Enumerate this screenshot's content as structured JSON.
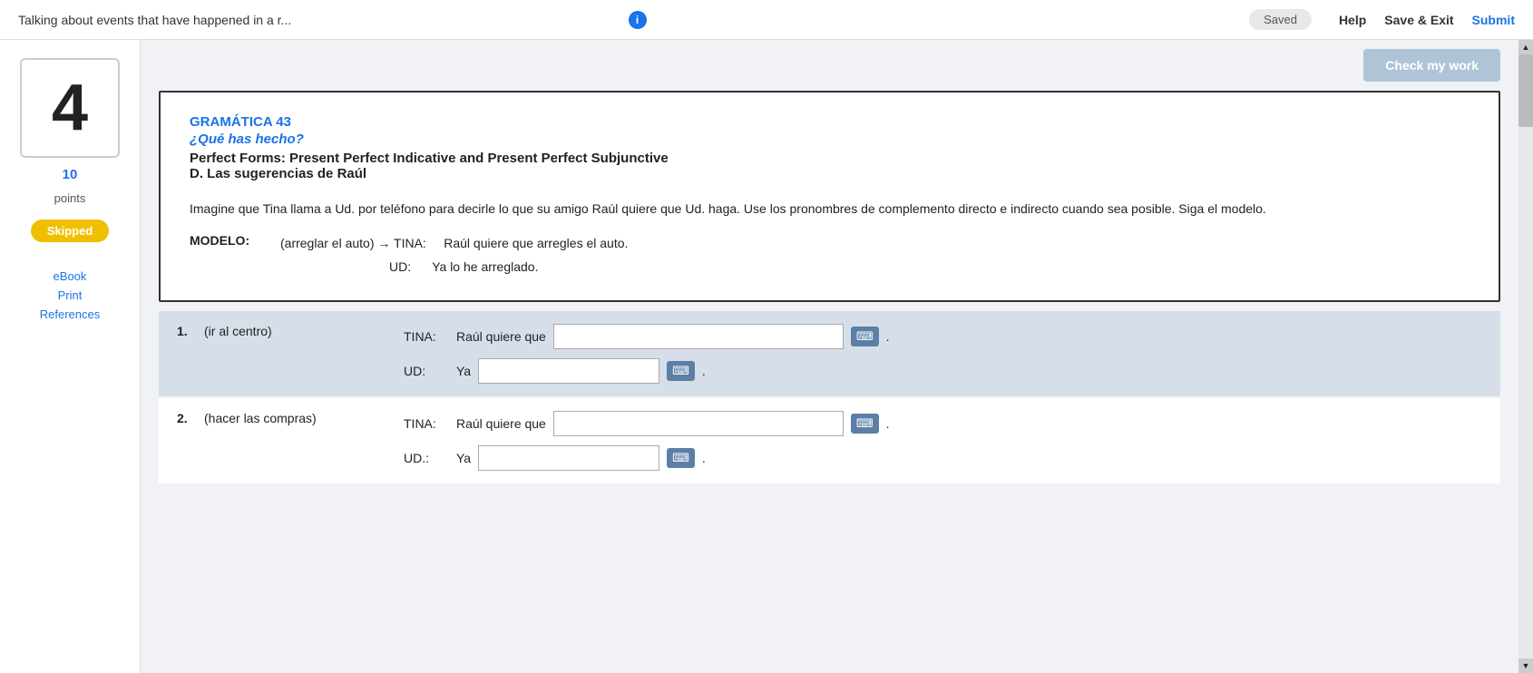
{
  "topbar": {
    "title": "Talking about events that have happened in a r...",
    "saved_label": "Saved",
    "help_label": "Help",
    "save_exit_label": "Save & Exit",
    "submit_label": "Submit"
  },
  "sidebar": {
    "question_number": "4",
    "points_value": "10",
    "points_label": "points",
    "skipped_label": "Skipped",
    "ebook_label": "eBook",
    "print_label": "Print",
    "references_label": "References"
  },
  "check_btn_label": "Check my work",
  "grammar_card": {
    "grammar_label": "GRAMÁTICA 43",
    "subtitle": "¿Qué has hecho?",
    "title": "Perfect Forms: Present Perfect Indicative and Present Perfect Subjunctive",
    "section": "D. Las sugerencias de Raúl",
    "instructions": "Imagine que Tina llama a Ud. por teléfono para decirle lo que su amigo Raúl quiere que Ud. haga. Use los pronombres de complemento directo e indirecto cuando sea posible. Siga el modelo.",
    "modelo_label": "MODELO:",
    "modelo_hint": "(arreglar el auto) → TINA:",
    "modelo_tina": "Raúl quiere que arregles el auto.",
    "modelo_ud_label": "UD:",
    "modelo_ud": "Ya lo he arreglado."
  },
  "exercises": [
    {
      "number": "1.",
      "hint": "(ir al centro)",
      "tina_label": "TINA:",
      "tina_prefix": "Raúl quiere que",
      "tina_placeholder": "",
      "ud_label": "UD:",
      "ud_prefix": "Ya",
      "ud_placeholder": ""
    },
    {
      "number": "2.",
      "hint": "(hacer las compras)",
      "tina_label": "TINA:",
      "tina_prefix": "Raúl quiere que",
      "tina_placeholder": "",
      "ud_label": "UD.:",
      "ud_prefix": "Ya",
      "ud_placeholder": ""
    }
  ]
}
